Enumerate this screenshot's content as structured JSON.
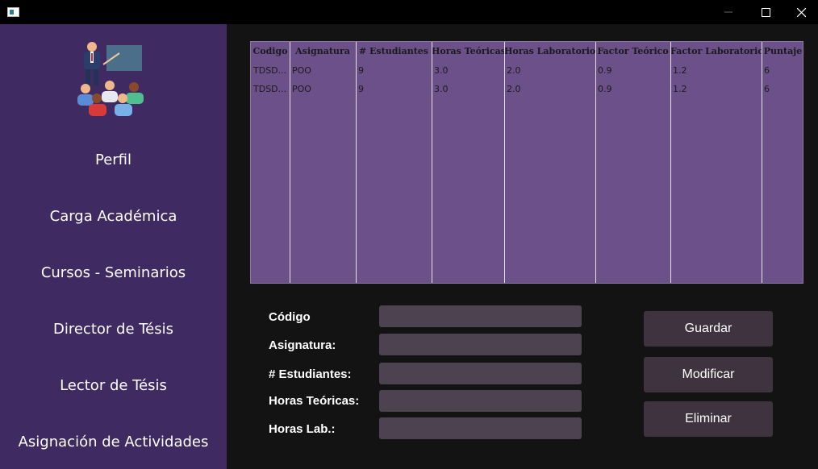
{
  "window": {
    "title": ""
  },
  "sidebar": {
    "items": [
      {
        "label": "Perfil"
      },
      {
        "label": "Carga Académica"
      },
      {
        "label": "Cursos - Seminarios"
      },
      {
        "label": "Director de Tésis"
      },
      {
        "label": "Lector de Tésis"
      },
      {
        "label": "Asignación de Actividades"
      }
    ]
  },
  "table": {
    "headers": [
      "Codigo",
      "Asignatura",
      "# Estudiantes",
      "Horas Teóricas",
      "Horas Laboratorio",
      "Factor Teórico",
      "Factor Laboratorio",
      "Puntaje"
    ],
    "rows": [
      [
        "TDSD...",
        "POO",
        "9",
        "3.0",
        "2.0",
        "0.9",
        "1.2",
        "6"
      ],
      [
        "TDSD...",
        "POO",
        "9",
        "3.0",
        "2.0",
        "0.9",
        "1.2",
        "6"
      ]
    ]
  },
  "form": {
    "codigo_label": "Código",
    "asignatura_label": "Asignatura:",
    "estudiantes_label": "# Estudiantes:",
    "horas_teoricas_label": "Horas Teóricas:",
    "horas_lab_label": "Horas Lab.:",
    "codigo_value": "",
    "asignatura_value": "",
    "estudiantes_value": "",
    "horas_teoricas_value": "",
    "horas_lab_value": ""
  },
  "actions": {
    "guardar": "Guardar",
    "modificar": "Modificar",
    "eliminar": "Eliminar"
  },
  "colors": {
    "sidebar": "#3f2a62",
    "table_bg": "#6c5089",
    "field_bg": "#4d424f",
    "button_bg": "#3f333f"
  }
}
